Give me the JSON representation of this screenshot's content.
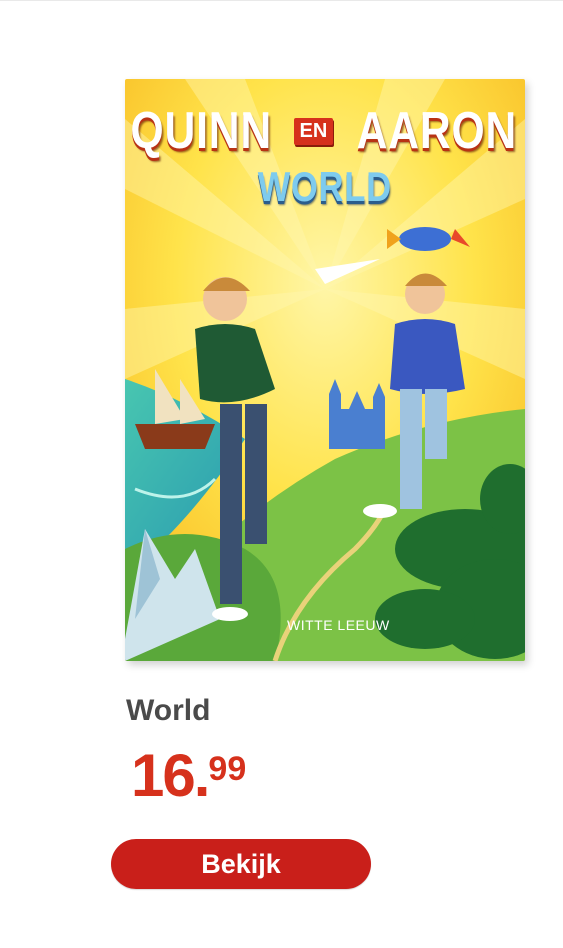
{
  "cover": {
    "title_part1": "QUINN",
    "title_connector": "EN",
    "title_part2": "AARON",
    "subtitle": "WORLD",
    "publisher": "WITTE LEEUW"
  },
  "product": {
    "name": "World",
    "price_whole": "16",
    "price_separator": ".",
    "price_cents": "99"
  },
  "cta": {
    "label": "Bekijk"
  },
  "colors": {
    "price": "#d6311c",
    "button": "#c91f1a",
    "name": "#4a4a4a"
  }
}
